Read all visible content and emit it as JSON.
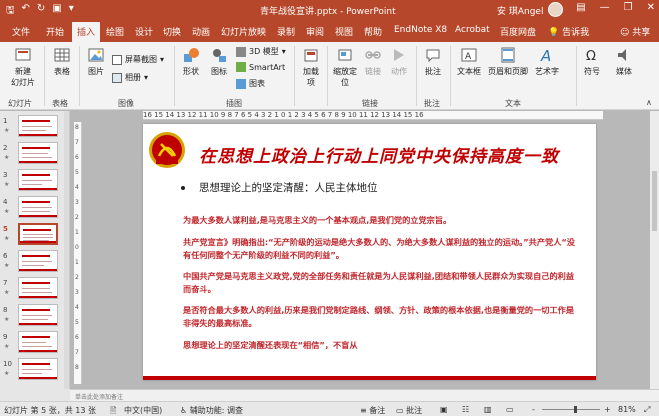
{
  "titlebar": {
    "title": "青年战役宣讲.pptx - PowerPoint",
    "user": "安 琪Angel",
    "icons": [
      "save-icon",
      "undo-icon",
      "redo-icon",
      "present-icon",
      "customize-icon"
    ],
    "window_controls": [
      "minimize-icon",
      "restore-icon",
      "close-icon"
    ]
  },
  "tabs": {
    "items": [
      "文件",
      "开始",
      "插入",
      "绘图",
      "设计",
      "切换",
      "动画",
      "幻灯片放映",
      "录制",
      "审阅",
      "视图",
      "帮助",
      "EndNote X8",
      "Acrobat",
      "百度网盘"
    ],
    "active": "插入",
    "tell_me": "告诉我",
    "share": "共享"
  },
  "ribbon": {
    "new_slide": "新建\n幻灯片",
    "table": "表格",
    "picture": "图片",
    "screenshot": "屏幕截图",
    "album": "相册",
    "shapes": "形状",
    "icons": "图标",
    "model3d": "3D 模型",
    "smartart": "SmartArt",
    "chart": "图表",
    "addins": "加载\n项",
    "zoom": "缩放定\n位",
    "link": "链接",
    "action": "动作",
    "comment": "批注",
    "textbox": "文本框",
    "header_footer": "页眉和页脚",
    "wordart": "艺术字",
    "symbol": "符号",
    "media": "媒体",
    "groups": {
      "slides": "幻灯片",
      "tables": "表格",
      "images": "图像",
      "illustrations": "插图",
      "links": "链接",
      "comments": "批注",
      "text": "文本"
    }
  },
  "thumbnails": {
    "items": [
      {
        "num": "1"
      },
      {
        "num": "2"
      },
      {
        "num": "3"
      },
      {
        "num": "4"
      },
      {
        "num": "5"
      },
      {
        "num": "6"
      },
      {
        "num": "7"
      },
      {
        "num": "8"
      },
      {
        "num": "9"
      },
      {
        "num": "10"
      }
    ],
    "active_index": 4
  },
  "ruler": {
    "h_marks": "16 15 14 13 12 11 10  9  8  7  6  5  4  3  2  1  0  1  2  3  4  5  6  7  8  9 10 11 12 13 14 15 16",
    "v_marks": [
      "8",
      "7",
      "6",
      "5",
      "4",
      "3",
      "2",
      "1",
      "0",
      "1",
      "2",
      "3",
      "4",
      "5",
      "6",
      "7",
      "8"
    ]
  },
  "slide": {
    "title": "在思想上政治上行动上同党中央保持高度一致",
    "bullet": "思想理论上的坚定清醒：人民主体地位",
    "paragraphs": [
      "为最大多数人谋利益,是马克思主义的一个基本观点,是我们党的立党宗旨。",
      "共产党宣言》明确指出:“无产阶级的运动是绝大多数人的、为绝大多数人谋利益的独立的运动。”共产党人“没有任何同整个无产阶级的利益不同的利益”。",
      "中国共产党是马克思主义政党,党的全部任务和责任就是为人民谋利益,团结和带领人民群众为实现自己的利益而奋斗。",
      "是否符合最大多数人的利益,历来是我们党制定路线、纲领、方针、政策的根本依据,也是衡量党的一切工作是非得失的最高标准。",
      "思想理论上的坚定清醒还表现在“相信”，不盲从"
    ]
  },
  "notes": {
    "placeholder": "单击此处添加备注"
  },
  "status": {
    "slide_info": "幻灯片 第 5 张，共 13 张",
    "language": "中文(中国)",
    "accessibility": "辅助功能: 调查",
    "notes_btn": "备注",
    "comments_btn": "批注",
    "zoom_minus": "-",
    "zoom_plus": "+",
    "zoom": "81%"
  },
  "colors": {
    "brand": "#b7472a",
    "slide_red": "#c00000",
    "text_red": "#c0272d"
  }
}
